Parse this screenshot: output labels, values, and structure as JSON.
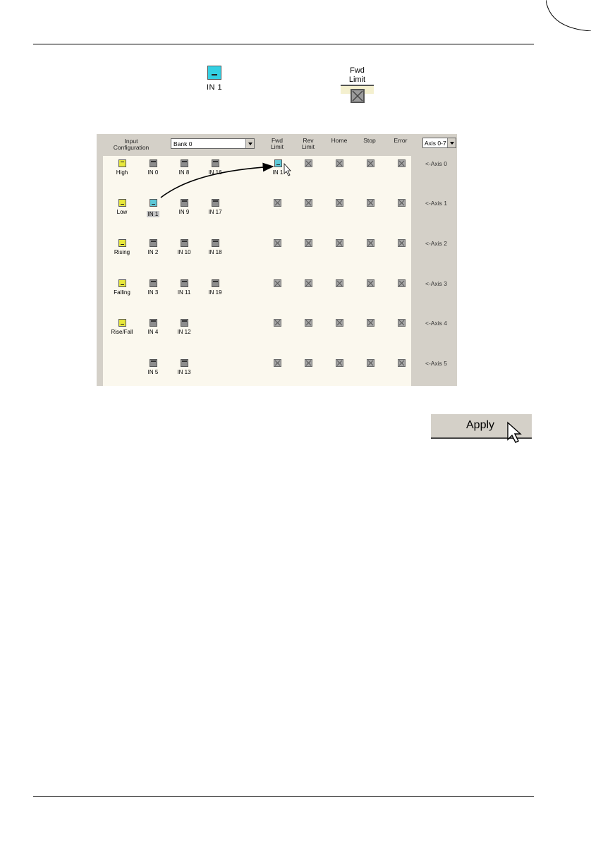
{
  "callouts": {
    "in_icon_label": "IN 1",
    "fwd_limit_label": "Fwd Limit"
  },
  "panel": {
    "input_config_header": [
      "Input",
      "Configuration"
    ],
    "bank_select_value": "Bank 0",
    "axis_select_value": "Axis 0-7",
    "columns": [
      {
        "line1": "Fwd",
        "line2": "Limit"
      },
      {
        "line1": "Rev",
        "line2": "Limit"
      },
      {
        "line1": "Home",
        "line2": ""
      },
      {
        "line1": "Stop",
        "line2": ""
      },
      {
        "line1": "Error",
        "line2": ""
      }
    ],
    "config_types": [
      "High",
      "Low",
      "Rising",
      "Falling",
      "Rise/Fall"
    ],
    "inputs_col1": [
      "IN 0",
      "IN 1",
      "IN 2",
      "IN 3",
      "IN 4",
      "IN 5"
    ],
    "inputs_col2": [
      "IN 8",
      "IN 9",
      "IN 10",
      "IN 11",
      "IN 12",
      "IN 13"
    ],
    "inputs_col3": [
      "IN 16",
      "IN 17",
      "IN 18",
      "IN 19"
    ],
    "assigned_fwd_limit_axis0": "IN 1",
    "axis_labels": [
      "<-Axis 0",
      "<-Axis 1",
      "<-Axis 2",
      "<-Axis 3",
      "<-Axis 4",
      "<-Axis 5"
    ]
  },
  "apply_button_label": "Apply",
  "colors": {
    "selected_input": "#5ec9d8",
    "config_type": "#e8e83c",
    "unassigned_input": "#8d8d8d",
    "grid_background": "#fbf8ee",
    "panel_background": "#d4d0c8"
  }
}
